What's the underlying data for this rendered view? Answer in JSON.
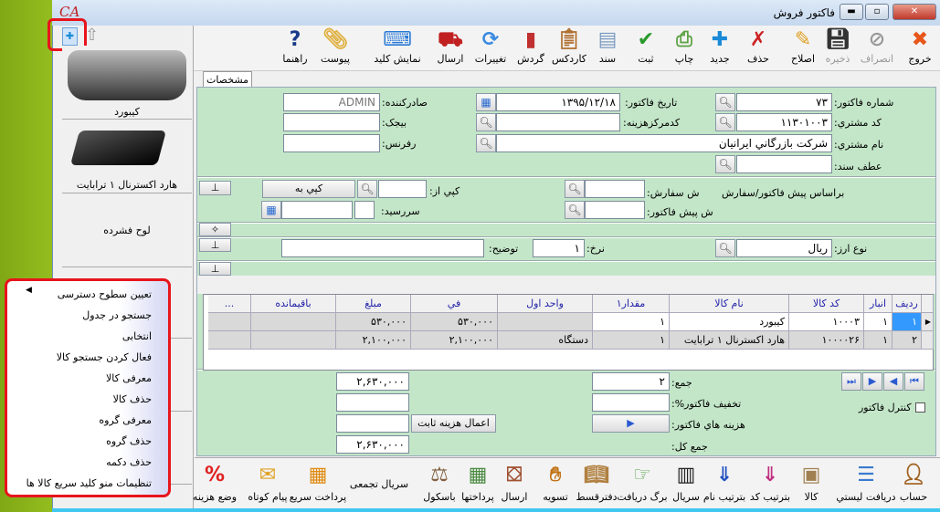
{
  "window": {
    "title": "فاکتور فروش",
    "logo": "CA",
    "controls": [
      "minimize",
      "maximize",
      "close"
    ]
  },
  "toolbar": [
    {
      "label": "خروج",
      "icon": "close-x-icon",
      "color": "#e8561a",
      "enabled": true
    },
    {
      "label": "انصراف",
      "icon": "cancel-icon",
      "color": "#999999",
      "enabled": false
    },
    {
      "label": "ذخیره",
      "icon": "save-floppy-icon",
      "color": "#333333",
      "enabled": false
    },
    {
      "label": "اصلاح",
      "icon": "edit-pencil-icon",
      "color": "#e0a020",
      "enabled": true
    },
    {
      "label": "حذف",
      "icon": "delete-doc-icon",
      "color": "#cc2222",
      "enabled": true
    },
    {
      "label": "جدید",
      "icon": "new-doc-icon",
      "color": "#1a8ad6",
      "enabled": true
    },
    {
      "label": "چاپ",
      "icon": "printer-icon",
      "color": "#5aa040",
      "enabled": true
    },
    {
      "label": "ثبت",
      "icon": "check-doc-icon",
      "color": "#2a9a2a",
      "enabled": true
    },
    {
      "label": "سند",
      "icon": "document-icon",
      "color": "#7a9ac0",
      "enabled": true
    },
    {
      "label": "کاردکس",
      "icon": "clipboard-icon",
      "color": "#b07030",
      "enabled": true
    },
    {
      "label": "گردش",
      "icon": "bar-chart-icon",
      "color": "#c03030",
      "enabled": true
    },
    {
      "label": "تغییرات",
      "icon": "refresh-icon",
      "color": "#3a8ae0",
      "enabled": true
    },
    {
      "label": "ارسال",
      "icon": "truck-icon",
      "color": "#c02020",
      "enabled": true
    },
    {
      "label": "نمایش کلید",
      "icon": "keyboard-icon",
      "color": "#2a7ad6",
      "enabled": true
    },
    {
      "label": "پیوست",
      "icon": "paperclip-icon",
      "color": "#e0b040",
      "enabled": true
    },
    {
      "label": "راهنما",
      "icon": "help-icon",
      "color": "#1a3a8a",
      "enabled": true
    }
  ],
  "left_panel": {
    "tiles": [
      {
        "label": "کیبورد"
      },
      {
        "label": "هارد اکسترنال ۱ ترابایت"
      },
      {
        "label": "لوح فشرده"
      }
    ],
    "context_menu": [
      "تعیین سطوح دسترسی",
      "جستجو در جدول",
      "انتخابی",
      "فعال کردن جستجو کالا",
      "معرفی کالا",
      "حذف کالا",
      "معرفی گروه",
      "حذف گروه",
      "حذف دکمه",
      "تنظیمات منو کلید سریع کالا ها"
    ]
  },
  "tab": "مشخصات",
  "form": {
    "invoice_no": {
      "label": "شماره فاکتور:",
      "value": "۷۳"
    },
    "invoice_date": {
      "label": "تاریخ فاکتور:",
      "value": "۱۳۹۵/۱۲/۱۸"
    },
    "issuer": {
      "label": "صادرکننده:",
      "value": "ADMIN"
    },
    "customer_code": {
      "label": "کد مشتري:",
      "value": "۱۱۳۰۱۰۰۳"
    },
    "cost_center": {
      "label": "کدمرکزهزینه:",
      "value": ""
    },
    "bijak": {
      "label": "بیجک:",
      "value": ""
    },
    "customer_name": {
      "label": "نام مشتري:",
      "value": "شرکت بازرگاني ايرانيان"
    },
    "reference": {
      "label": "رفرنس:",
      "value": ""
    },
    "doc_ref": {
      "label": "عطف سند:",
      "value": ""
    },
    "based_on": "براساس پیش فاکتور/سفارش",
    "order_no": {
      "label": "ش سفارش:",
      "value": ""
    },
    "proforma_no": {
      "label": "ش پیش فاکتور:",
      "value": ""
    },
    "copy_from": {
      "label": "کپي از:",
      "value": ""
    },
    "copy_to": "کپي به",
    "due_date": {
      "label": "سررسید:",
      "value": ""
    },
    "currency": {
      "label": "نوع ارز:",
      "value": "ريال"
    },
    "rate": {
      "label": "نرخ:",
      "value": "۱"
    },
    "description": {
      "label": "توضیح:",
      "value": ""
    }
  },
  "grid": {
    "columns": [
      "رديف",
      "انبار",
      "کد کالا",
      "نام کالا",
      "مقدار۱",
      "واحد اول",
      "في",
      "مبلغ",
      "باقيمانده",
      "..."
    ],
    "rows": [
      [
        "۱",
        "۱",
        "۱۰۰۰۳",
        "کیبورد",
        "۱",
        "",
        "۵۳۰,۰۰۰",
        "۵۳۰,۰۰۰",
        "",
        ""
      ],
      [
        "۲",
        "۱",
        "۱۰۰۰۰۲۶",
        "هارد اکسترنال ۱ ترابایت",
        "۱",
        "دستگاه",
        "۲,۱۰۰,۰۰۰",
        "۲,۱۰۰,۰۰۰",
        "",
        ""
      ]
    ]
  },
  "totals": {
    "sum": {
      "label": "جمع:",
      "count": "۲",
      "amount": "۲,۶۳۰,۰۰۰"
    },
    "discount": {
      "label": "تخفیف فاکتور%:",
      "value": "",
      "amount": ""
    },
    "costs": {
      "label": "هزینه هاي فاکتور:",
      "amount": ""
    },
    "apply_fixed_cost": "اعمال هزینه ثابت",
    "grand_total": {
      "label": "جمع کل:",
      "amount": "۲,۶۳۰,۰۰۰"
    },
    "invoice_control": {
      "label": "کنترل فاکتور",
      "checked": false
    }
  },
  "bottom_toolbar": [
    {
      "label": "حساب",
      "icon": "accountant-icon",
      "color": "#a06020"
    },
    {
      "label": "دریافت لیستي",
      "icon": "list-receive-icon",
      "color": "#3a7ad0"
    },
    {
      "label": "کالا",
      "icon": "box-icon",
      "color": "#a08050"
    },
    {
      "label": "بترتیب کد",
      "icon": "sort-numeric-icon",
      "color": "#c03080"
    },
    {
      "label": "بترتیب نام",
      "icon": "sort-alpha-icon",
      "color": "#2050c0"
    },
    {
      "label": "سریال",
      "icon": "barcode-icon",
      "color": "#222222"
    },
    {
      "label": "برگ دریافت",
      "icon": "receipt-icon",
      "color": "#50a040"
    },
    {
      "label": "دفترقسط",
      "icon": "book-icon",
      "color": "#b08040"
    },
    {
      "label": "تسویه",
      "icon": "handshake-icon",
      "color": "#c07010"
    },
    {
      "label": "ارسال",
      "icon": "hand-truck-icon",
      "color": "#a05030"
    },
    {
      "label": "پرداختها",
      "icon": "money-icon",
      "color": "#4a8a40"
    },
    {
      "label": "باسکول",
      "icon": "scale-icon",
      "color": "#806040"
    },
    {
      "label": "سریال تجمعی",
      "icon": "",
      "color": ""
    },
    {
      "label": "پرداخت سریع",
      "icon": "pos-terminal-icon",
      "color": "#e08a10"
    },
    {
      "label": "پیام کوتاه",
      "icon": "sms-icon",
      "color": "#e0a020"
    },
    {
      "label": "وضع هزینه",
      "icon": "percent-icon",
      "color": "#e02020"
    }
  ]
}
